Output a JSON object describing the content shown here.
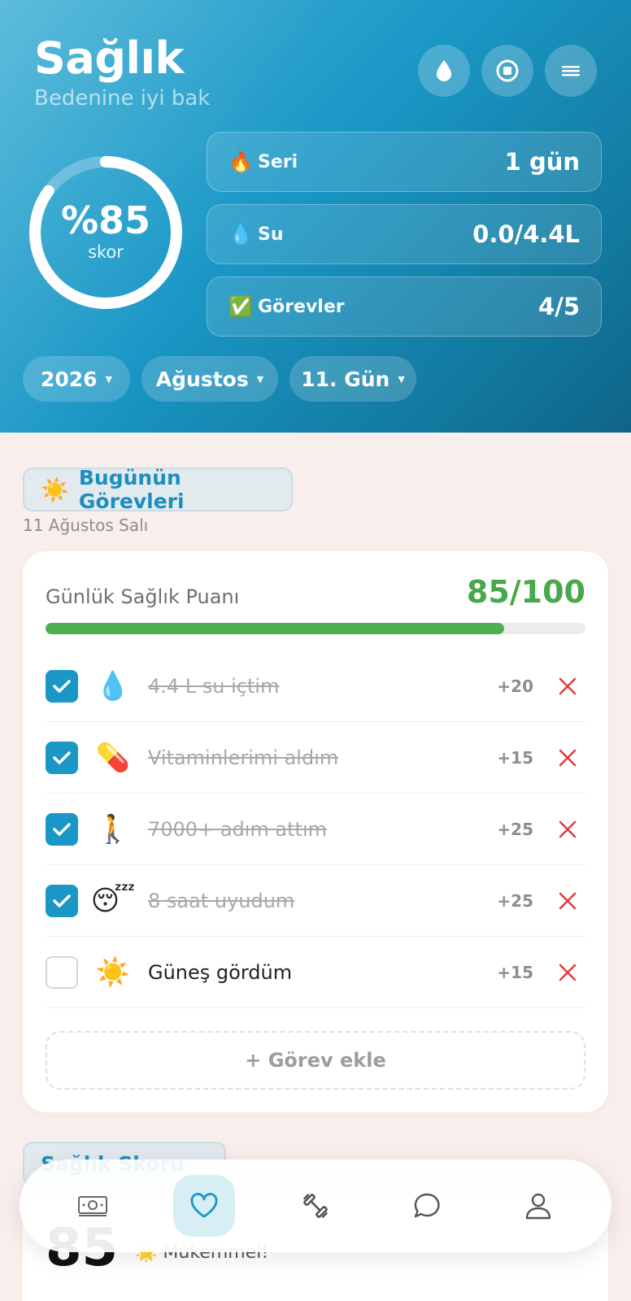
{
  "header": {
    "title": "Sağlık",
    "subtitle": "Bedenine iyi bak",
    "buttons": [
      "water-drop-icon",
      "stop-icon",
      "menu-icon"
    ]
  },
  "score_ring": {
    "percent_label": "%85",
    "label": "skor",
    "progress": 0.85
  },
  "stats": [
    {
      "emoji": "🔥",
      "label": "Seri",
      "value": "1 gün"
    },
    {
      "emoji": "💧",
      "label": "Su",
      "value": "0.0/4.4L"
    },
    {
      "emoji": "✅",
      "label": "Görevler",
      "value": "4/5"
    }
  ],
  "filters": {
    "year": "2026",
    "month": "Ağustos",
    "day": "11. Gün"
  },
  "today": {
    "section_emoji": "☀️",
    "section_title": "Bugünün Görevleri",
    "date": "11 Ağustos Salı",
    "score_label": "Günlük Sağlık Puanı",
    "score_value": "85/100",
    "score_fraction": 0.85,
    "tasks": [
      {
        "emoji": "💧",
        "name": "4.4 L su içtim",
        "points": "+20",
        "done": true
      },
      {
        "emoji": "💊",
        "name": "Vitaminlerimi aldım",
        "points": "+15",
        "done": true
      },
      {
        "emoji": "🚶",
        "name": "7000+ adım attım",
        "points": "+25",
        "done": true
      },
      {
        "emoji": "😴",
        "name": "8 saat uyudum",
        "points": "+25",
        "done": true
      },
      {
        "emoji": "☀️",
        "name": "Güneş gördüm",
        "points": "+15",
        "done": false
      }
    ],
    "add_task_label": "+ Görev ekle"
  },
  "health_score": {
    "section_title": "Sağlık Skoru",
    "value": "85",
    "emoji": "🌟",
    "status": "Mükemmel!"
  },
  "nav": {
    "items": [
      "money-icon",
      "heart-icon",
      "dumbbell-icon",
      "chat-icon",
      "profile-icon"
    ],
    "active_index": 1
  },
  "colors": {
    "accent": "#1a97c6",
    "score_green": "#48a84a",
    "delete_red": "#e03c3c"
  }
}
